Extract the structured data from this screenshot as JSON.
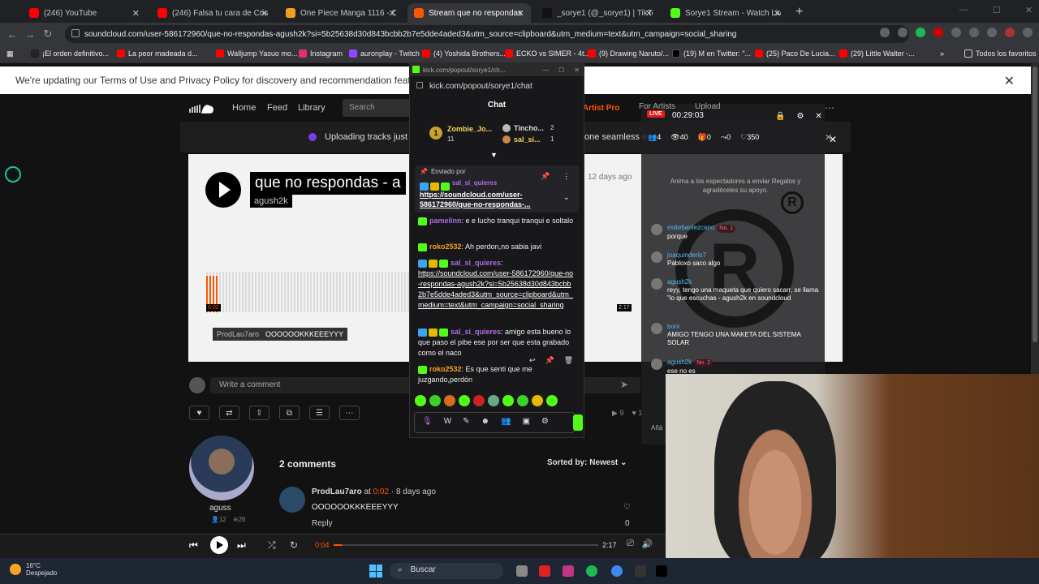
{
  "browser": {
    "tabs": [
      {
        "title": "(246) YouTube",
        "color": "#ff0000"
      },
      {
        "title": "(246) Falsa tu cara de Cristo - Y",
        "color": "#ff0000"
      },
      {
        "title": "One Piece Manga 1116 - One P",
        "color": "#f0a020"
      },
      {
        "title": "Stream que no respondas - agu",
        "color": "#ff5500"
      },
      {
        "title": "_sorye1 (@_sorye1) | TikTok",
        "color": "#111111"
      },
      {
        "title": "Sorye1 Stream - Watch Live on",
        "color": "#53fc18"
      }
    ],
    "active_tab": "Stream que no respondas - agu",
    "url": "soundcloud.com/user-586172960/que-no-respondas-agush2k?si=5b25638d30d843bcbb2b7e5dde4aded3&utm_source=clipboard&utm_medium=text&utm_campaign=social_sharing",
    "bookmarks": [
      {
        "label": "¡El orden definitivo...",
        "color": "#222222"
      },
      {
        "label": "La peor madeada d...",
        "color": "#ff0000"
      },
      {
        "label": "Walljump Yasuo mo...",
        "color": "#ff0000"
      },
      {
        "label": "Instagram",
        "color": "#e1306c"
      },
      {
        "label": "auronplay - Twitch",
        "color": "#9146ff"
      },
      {
        "label": "(4) Yoshida Brothers...",
        "color": "#ff0000"
      },
      {
        "label": "ECKO vs SIMER - 4t...",
        "color": "#ff0000"
      },
      {
        "label": "(9) Drawing Naruto/...",
        "color": "#ff0000"
      },
      {
        "label": "(19) M en Twitter: \"...",
        "color": "#000000"
      },
      {
        "label": "(25) Paco De Lucia...",
        "color": "#ff0000"
      },
      {
        "label": "(29) Little Walter -...",
        "color": "#ff0000"
      }
    ],
    "all_bookmarks": "Todos los favoritos"
  },
  "soundcloud": {
    "banner": "We're updating our Terms of Use and Privacy Policy for discovery and recommendation features.",
    "nav": {
      "home": "Home",
      "feed": "Feed",
      "library": "Library",
      "search_placeholder": "Search",
      "try_pro": "ry Artist Pro",
      "for_artists": "For Artists",
      "upload": "Upload"
    },
    "upload_banner": "Uploading tracks just g",
    "upload_banner_right": "one seamless ex",
    "track": {
      "title": "que no respondas - a",
      "artist": "agush2k",
      "posted": "12 days ago",
      "time_current": "0:02",
      "time_total": "2:17"
    },
    "waveform_comment": {
      "user": "ProdLau7aro",
      "text": "OOOOOOKKKEEEYYY"
    },
    "write_comment_placeholder": "Write a comment",
    "stats_right": {
      "plays": "9",
      "likes": "1"
    },
    "uploader": {
      "name": "aguss",
      "followers": "12",
      "tracks": "26"
    },
    "comments_heading": "2 comments",
    "sort": "Sorted by: Newest",
    "comments": [
      {
        "user": "ProdLau7aro",
        "at": "at",
        "time": "0:02",
        "age": "· 8 days ago",
        "text": "OOOOOOKKKEEEYYY",
        "reply": "Reply",
        "likes": "0"
      }
    ],
    "player": {
      "elapsed": "0:04",
      "total": "2:17",
      "progress": 0.03
    }
  },
  "kick_popout": {
    "window_title": "kick.com/popout/sorye1/ch...",
    "url": "kick.com/popout/sorye1/chat",
    "heading": "Chat",
    "gifters": [
      {
        "rank": "1",
        "name": "Zombie_Jo...",
        "count": "11"
      },
      {
        "name": "Tincho...",
        "count": "2"
      },
      {
        "name": "sal_si...",
        "count": "1"
      }
    ],
    "pinned": {
      "label": "Enviado por",
      "user": "sal_si_quieres",
      "link": "https://soundcloud.com/user-586172960/que-no-respondas-..."
    },
    "messages": [
      {
        "user": "pamelinn",
        "user_color": "#b16ae6",
        "text": ": e e lucho tranqui tranqui e soltalo"
      },
      {
        "user": "roko2532",
        "user_color": "#f0a020",
        "text": ": Ah perdon,no sabia javi"
      },
      {
        "user": "sal_si_quieres",
        "user_color": "#b16ae6",
        "text": ":",
        "link": "https://soundcloud.com/user-586172960/que-no-respondas-agush2k?si=5b25638d30d843bcbb2b7e5dde4aded3&utm_source=clipboard&utm_medium=text&utm_campaign=social_sharing"
      },
      {
        "user": "sal_si_quieres",
        "user_color": "#b16ae6",
        "text": ": amigo esta bueno lo que paso el pibe ese por ser que esta grabado como el naco"
      },
      {
        "user": "roko2532",
        "user_color": "#f0a020",
        "text": ": Es que senti que me juzgando,perdón"
      }
    ]
  },
  "stream_overlay": {
    "live_label": "LIVE",
    "uptime": "00:29:03",
    "stats": {
      "a": "4",
      "viewers": "40",
      "gifts": "0",
      "b": "0",
      "likes": "350"
    },
    "hint": "Anima a los espectadores a enviar Regalos y agradéceles su apoyo.",
    "messages": [
      {
        "user": "esttebanlezcano",
        "rank": "No. 1",
        "text": "porque"
      },
      {
        "user": "joaquinderio7",
        "text": "Pabloxo saco algo"
      },
      {
        "user": "agush2k",
        "text": "reyy, tengo una maqueta que quiero sacarr, se llama \"lo que escuchas - agush2k en soundcloud"
      },
      {
        "user": "boni",
        "text": "AMIGO TENGO UNA MAKETA DEL SISTEMA SOLAR"
      },
      {
        "user": "agush2k",
        "rank": "No. 2",
        "text": "ese no es"
      }
    ],
    "add_label": "Añá"
  },
  "taskbar": {
    "temp": "16°C",
    "weather": "Despejado",
    "search": "Buscar"
  }
}
